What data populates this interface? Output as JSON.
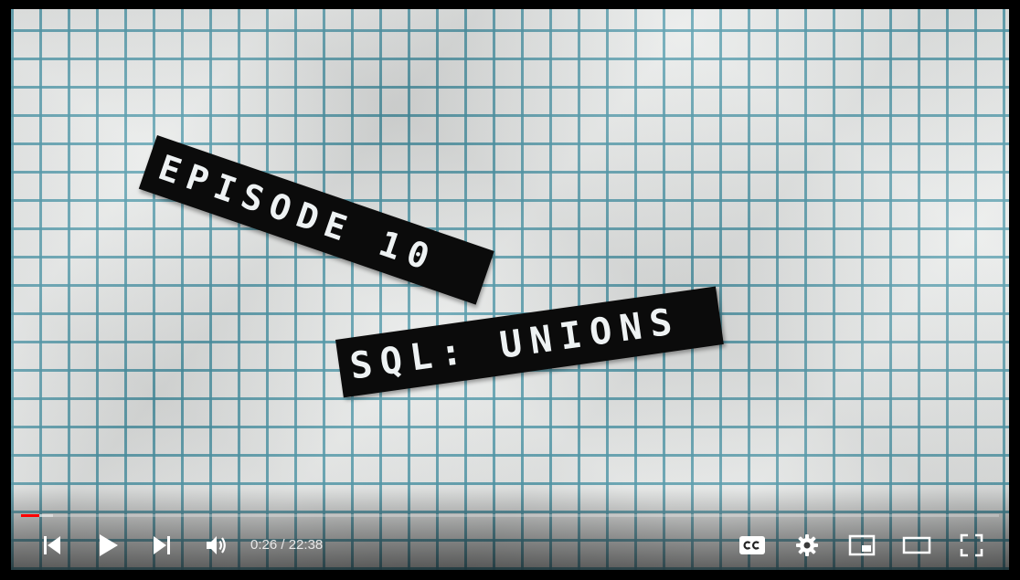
{
  "video": {
    "episode_label": "EPISODE 10",
    "topic_label": "SQL: UNIONS"
  },
  "progress": {
    "played_fraction": 0.019,
    "buffered_fraction": 0.033,
    "played_color": "#ff0000"
  },
  "controls": {
    "current_time": "0:26",
    "separator": " / ",
    "duration": "22:38",
    "buttons": {
      "previous": "previous-icon",
      "play": "play-icon",
      "next": "next-icon",
      "volume": "volume-icon",
      "subtitles": "subtitles-icon",
      "settings": "gear-icon",
      "miniplayer": "miniplayer-icon",
      "theater": "theater-mode-icon",
      "fullscreen": "fullscreen-icon"
    }
  }
}
